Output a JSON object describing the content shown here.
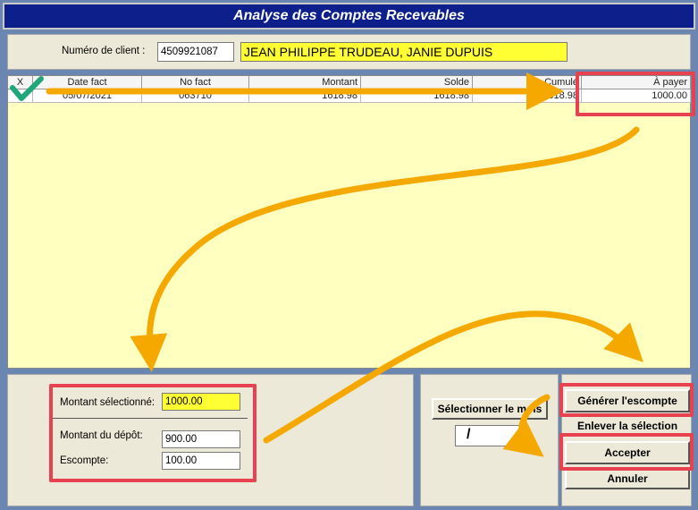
{
  "title": "Analyse des Comptes Recevables",
  "client": {
    "label": "Numéro de client :",
    "number": "4509921087",
    "name": "JEAN PHILIPPE TRUDEAU, JANIE DUPUIS"
  },
  "grid": {
    "columns": [
      "X",
      "Date fact",
      "No fact",
      "Montant",
      "Solde",
      "Cumulé",
      "À payer"
    ],
    "rows": [
      {
        "x": "",
        "date": "05/07/2021",
        "no": "063710",
        "montant": "1618.98",
        "solde": "1618.98",
        "cumule": "1618.98",
        "a_payer": "1000.00"
      }
    ]
  },
  "totals": {
    "selected_label": "Montant sélectionné:",
    "selected_value": "1000.00",
    "deposit_label": "Montant du dépôt:",
    "deposit_value": "900.00",
    "discount_label": "Escompte:",
    "discount_value": "100.00"
  },
  "month": {
    "button_label": "Sélectionner le mois",
    "value": "/"
  },
  "actions": {
    "generate_label": "Générer l'escompte",
    "remove_label": "Enlever la sélection",
    "accept_label": "Accepter",
    "cancel_label": "Annuler"
  },
  "colors": {
    "title_bg": "#0d1f8a",
    "highlight": "#ffff33",
    "annotation_box": "#e8414f",
    "arrow": "#f5a800",
    "check": "#1fa77a"
  },
  "icons": {
    "check": "checkmark-icon",
    "arrows": "annotation-arrow-icon"
  }
}
